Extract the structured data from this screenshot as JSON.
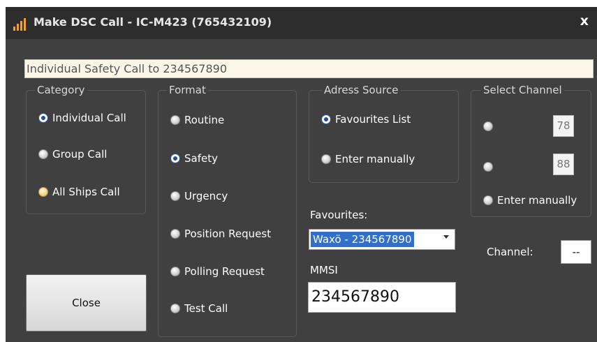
{
  "window": {
    "title": "Make DSC Call - IC-M423 (765432109)",
    "close_glyph": "x",
    "icon": "signal-bars-icon"
  },
  "summary": "Individual Safety Call to 234567890",
  "category": {
    "title": "Category",
    "options": [
      "Individual Call",
      "Group Call",
      "All Ships Call"
    ],
    "selected": "Individual Call"
  },
  "format": {
    "title": "Format",
    "options": [
      "Routine",
      "Safety",
      "Urgency",
      "Position Request",
      "Polling Request",
      "Test Call"
    ],
    "selected": "Safety"
  },
  "address_source": {
    "title": "Adress Source",
    "options": [
      "Favourites List",
      "Enter manually"
    ],
    "selected": "Favourites List"
  },
  "favourites": {
    "label": "Favourites:",
    "value": "Waxö - 234567890"
  },
  "mmsi": {
    "label": "MMSI",
    "value": "234567890"
  },
  "select_channel": {
    "title": "Select Channel",
    "channel_1": "78",
    "channel_2": "88",
    "manual_label": "Enter manually"
  },
  "channel": {
    "label": "Channel:",
    "value": "--"
  },
  "buttons": {
    "close": "Close"
  },
  "colors": {
    "window_bg": "#404040",
    "titlebar_bg": "#2d2d2d",
    "selection": "#3270c8",
    "summary_bg": "#fbf6e8"
  }
}
